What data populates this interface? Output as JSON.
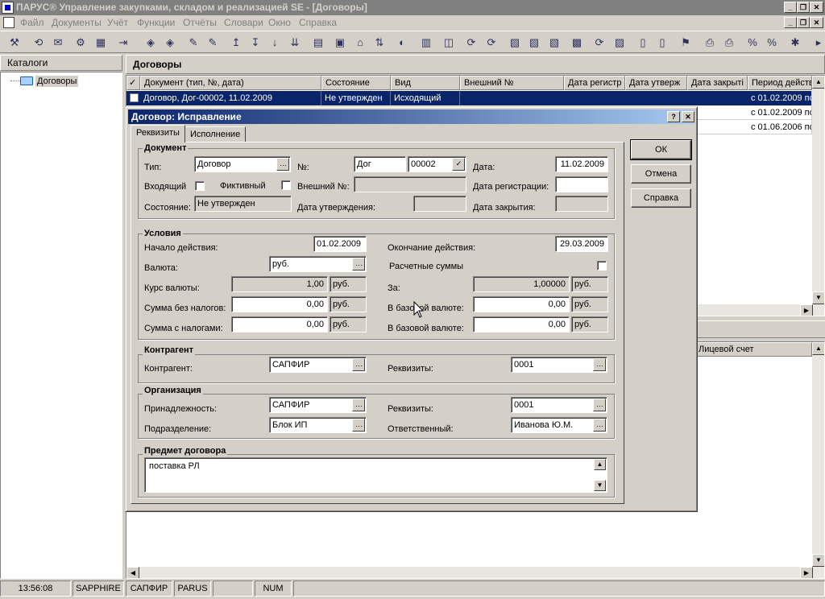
{
  "app": {
    "title": "ПАРУС® Управление закупками, складом и реализацией SE - [Договоры]"
  },
  "menu": [
    "Файл",
    "Документы",
    "Учёт",
    "Функции",
    "Отчёты",
    "Словари",
    "Окно",
    "Справка"
  ],
  "catalog_panel": {
    "title": "Каталоги",
    "tree_item": "Договоры"
  },
  "contracts_panel": {
    "title": "Договоры",
    "columns": [
      "Документ (тип, №, дата)",
      "Состояние",
      "Вид",
      "Внешний №",
      "Дата регистр",
      "Дата утверж",
      "Дата закрыті",
      "Период действия"
    ],
    "rows": [
      {
        "doc": "Договор, Дог-00002, 11.02.2009",
        "state": "Не утвержден",
        "kind": "Исходящий",
        "period": "с 01.02.2009 по"
      },
      {
        "doc": "",
        "state": "",
        "kind": "",
        "period": "с 01.02.2009 по"
      },
      {
        "doc": "",
        "state": "",
        "kind": "",
        "period": "с 01.06.2006 по"
      }
    ],
    "lower_header": "Лицевой счет"
  },
  "dialog": {
    "title": "Договор: Исправление",
    "tabs": [
      "Реквизиты",
      "Исполнение"
    ],
    "buttons": {
      "ok": "ОК",
      "cancel": "Отмена",
      "help": "Справка"
    },
    "document": {
      "group_title": "Документ",
      "type_label": "Тип:",
      "type_value": "Договор",
      "number_label": "№:",
      "prefix_value": "Дог",
      "number_value": "00002",
      "date_label": "Дата:",
      "date_value": "11.02.2009",
      "incoming_label": "Входящий",
      "fictive_label": "Фиктивный",
      "external_label": "Внешний №:",
      "external_value": "",
      "reg_date_label": "Дата регистрации:",
      "reg_date_value": "",
      "state_label": "Состояние:",
      "state_value": "Не утвержден",
      "approve_date_label": "Дата утверждения:",
      "approve_date_value": "",
      "close_date_label": "Дата закрытия:",
      "close_date_value": ""
    },
    "conditions": {
      "group_title": "Условия",
      "start_label": "Начало действия:",
      "start_value": "01.02.2009",
      "end_label": "Окончание действия:",
      "end_value": "29.03.2009",
      "currency_label": "Валюта:",
      "currency_value": "руб.",
      "calc_sums_label": "Расчетные суммы",
      "rate_label": "Курс валюты:",
      "rate_value": "1,00",
      "rate_unit": "руб.",
      "per_label": "За:",
      "per_value": "1,00000",
      "per_unit": "руб.",
      "sum_wo_tax_label": "Сумма без налогов:",
      "sum_wo_tax_value": "0,00",
      "sum_wo_tax_unit": "руб.",
      "base1_label": "В базовой валюте:",
      "base1_value": "0,00",
      "base1_unit": "руб.",
      "sum_w_tax_label": "Сумма с налогами:",
      "sum_w_tax_value": "0,00",
      "sum_w_tax_unit": "руб.",
      "base2_label": "В базовой валюте:",
      "base2_value": "0,00",
      "base2_unit": "руб."
    },
    "counterparty": {
      "group_title": "Контрагент",
      "label": "Контрагент:",
      "value": "САПФИР",
      "req_label": "Реквизиты:",
      "req_value": "0001"
    },
    "organization": {
      "group_title": "Организация",
      "belong_label": "Принадлежность:",
      "belong_value": "САПФИР",
      "req_label": "Реквизиты:",
      "req_value": "0001",
      "dept_label": "Подразделение:",
      "dept_value": "Блок ИП",
      "resp_label": "Ответственный:",
      "resp_value": "Иванова Ю.М."
    },
    "subject": {
      "group_title": "Предмет договора",
      "value": "поставка РЛ"
    }
  },
  "statusbar": {
    "time": "13:56:08",
    "db": "SAPPHIRE",
    "org": "САПФИР",
    "user": "PARUS",
    "num": "NUM"
  }
}
